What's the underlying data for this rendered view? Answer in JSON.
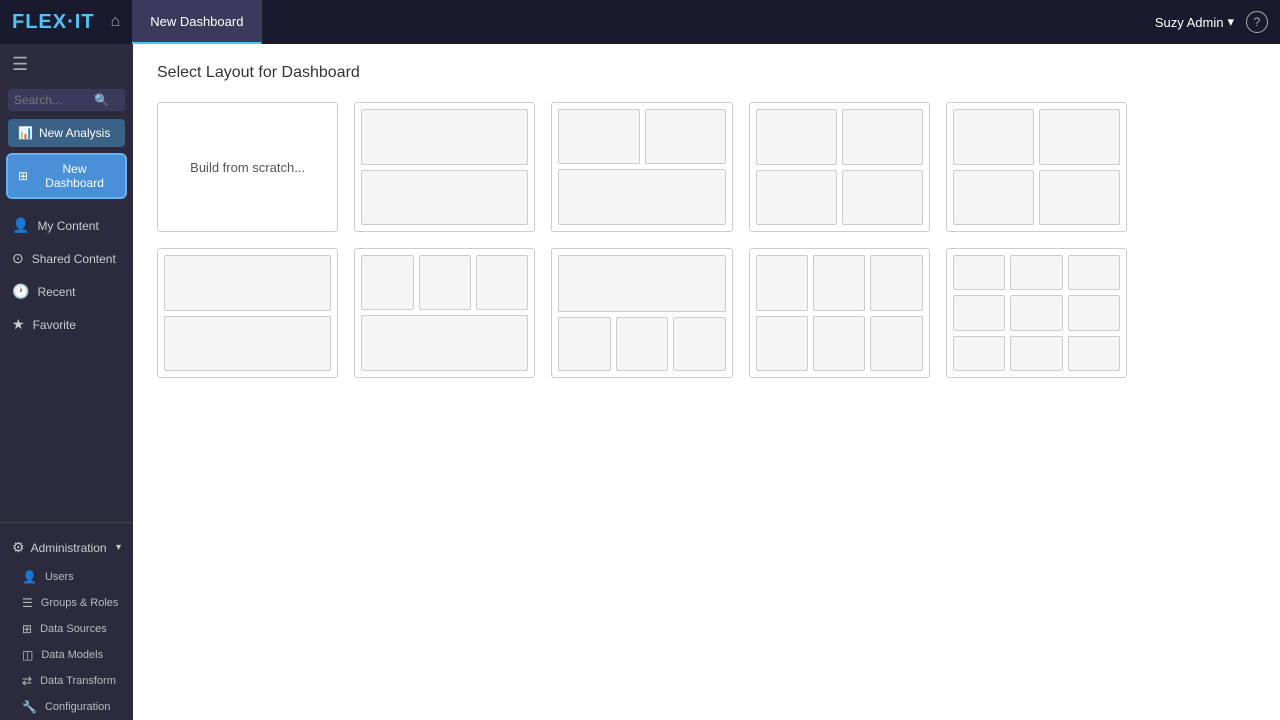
{
  "topbar": {
    "logo_text": "FLEX·IT",
    "logo_highlight": "IT",
    "active_tab": "New Dashboard",
    "user_label": "Suzy Admin",
    "user_dropdown": "▾",
    "help_label": "?"
  },
  "sidebar": {
    "search_placeholder": "Search...",
    "btn_new_analysis": "New Analysis",
    "btn_new_dashboard": "New Dashboard",
    "nav_items": [
      {
        "id": "my-content",
        "label": "My Content",
        "icon": "👤"
      },
      {
        "id": "shared-content",
        "label": "Shared Content",
        "icon": "⊙"
      },
      {
        "id": "recent",
        "label": "Recent",
        "icon": "🕐"
      },
      {
        "id": "favorite",
        "label": "Favorite",
        "icon": "★"
      }
    ],
    "admin": {
      "label": "Administration",
      "icon": "⚙",
      "chevron": "▾",
      "sub_items": [
        {
          "id": "users",
          "label": "Users",
          "icon": "👤"
        },
        {
          "id": "groups-roles",
          "label": "Groups & Roles",
          "icon": "☰"
        },
        {
          "id": "data-sources",
          "label": "Data Sources",
          "icon": "⊞"
        },
        {
          "id": "data-models",
          "label": "Data Models",
          "icon": "◫"
        },
        {
          "id": "data-transform",
          "label": "Data Transform",
          "icon": "⇄"
        },
        {
          "id": "configuration",
          "label": "Configuration",
          "icon": "🔧"
        }
      ]
    }
  },
  "content": {
    "page_title": "Select Layout for Dashboard",
    "build_scratch_label": "Build from scratch..."
  }
}
